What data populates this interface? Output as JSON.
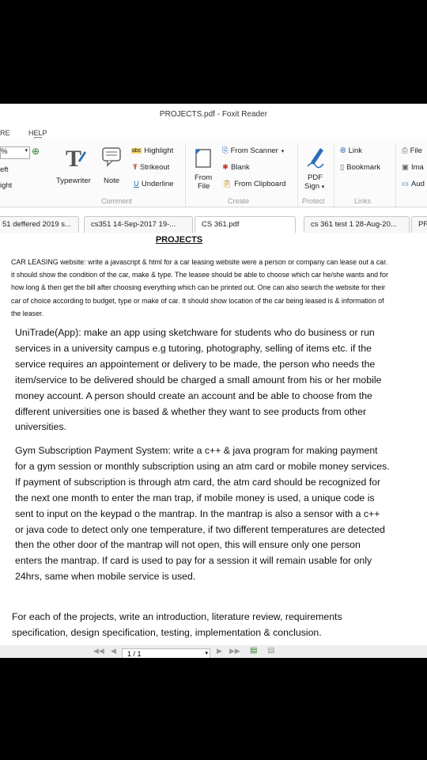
{
  "window": {
    "title": "PROJECTS.pdf - Foxit Reader"
  },
  "menu": {
    "partial_left": "RE",
    "help": "HELP",
    "help_key": "L"
  },
  "ribbon": {
    "zoom_partial": "%",
    "left_partial": "eft",
    "right_partial": "ight",
    "typewriter": "Typewriter",
    "note": "Note",
    "highlight": "Highlight",
    "strikeout": "Strikeout",
    "underline": "Underline",
    "comment_group": "Comment",
    "from_file_line1": "From",
    "from_file_line2": "File",
    "from_scanner": "From Scanner",
    "blank": "Blank",
    "from_clipboard": "From Clipboard",
    "create_group": "Create",
    "pdf_sign_line1": "PDF",
    "pdf_sign_line2": "Sign",
    "protect_group": "Protect",
    "link": "Link",
    "bookmark": "Bookmark",
    "links_group": "Links",
    "file_partial": "File",
    "image_partial": "Ima",
    "audio_partial": "Aud",
    "abc_badge": "abc"
  },
  "tabs": [
    {
      "label": "51 deffered 2019 s..."
    },
    {
      "label": "cs351 14-Sep-2017 19-..."
    },
    {
      "label": "CS 361.pdf"
    },
    {
      "label": "cs 361 test 1 28-Aug-20..."
    },
    {
      "label": "PR"
    }
  ],
  "document": {
    "title": "PROJECTS",
    "para1": "CAR LEASING website: write a javascript & html for a car leasing website were a person or company can lease out a car. it should show the condition of the car, make & type. The leasee should be able to choose which car he/she wants and for how long & then get the bill after choosing everything which can be printed out. One can also search the website for their car of choice according to budget, type or make of car. It should show location of the car being leased is & information of the leaser.",
    "para2": "UniTrade(App): make an app using sketchware for students who do business or run services in a university campus e.g tutoring, photography, selling of items etc. if the service requires an appointement  or delivery to be made, the person who needs the item/service to be delivered should be charged a small amount from his or her mobile money account. A person should create an account and be able to choose from the different universities one is based & whether they want to see products from other universities.",
    "para3": "Gym Subscription Payment System: write a c++ & java program for making payment for a gym session or monthly subscription using an atm card or mobile money services. If payment of subscription is through atm card, the atm card should be recognized for the next one month to enter the man trap, if mobile money is used, a unique code is sent to input on the keypad o the mantrap. In the mantrap is also a sensor with a c++ or java code to detect only one temperature, if two different temperatures are detected then the other door of the mantrap will not open, this will ensure only one person enters the mantrap. If card is used to pay for a session it will remain usable for only 24hrs, same when mobile service is used.",
    "para4": "For each of the projects, write an introduction, literature review, requirements specification, design specification, testing, implementation & conclusion."
  },
  "statusbar": {
    "page": "1 / 1"
  },
  "colors": {
    "accent": "#2a6ebb",
    "frame": "#000000"
  }
}
